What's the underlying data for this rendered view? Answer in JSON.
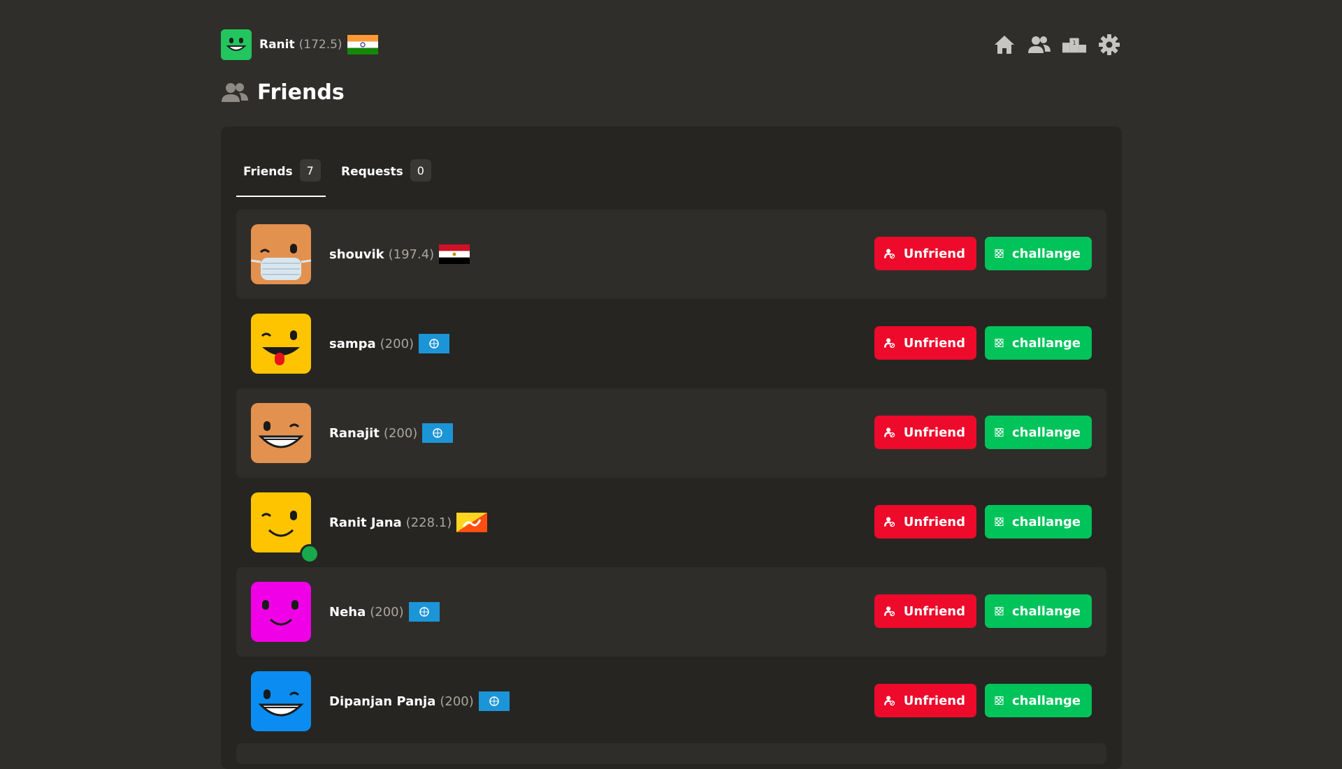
{
  "header": {
    "user": {
      "name": "Ranit",
      "rating": "(172.5)",
      "avatar_icon": "green-smile-avatar-icon",
      "flag": "india-flag-icon"
    },
    "nav": [
      {
        "name": "home-icon"
      },
      {
        "name": "friends-icon"
      },
      {
        "name": "leaderboard-icon"
      },
      {
        "name": "settings-icon"
      }
    ]
  },
  "page": {
    "title": "Friends",
    "title_icon": "friends-icon"
  },
  "tabs": [
    {
      "label": "Friends",
      "count": "7",
      "active": true
    },
    {
      "label": "Requests",
      "count": "0",
      "active": false
    }
  ],
  "buttons": {
    "unfriend_label": "Unfriend",
    "challenge_label": "challange"
  },
  "friends": [
    {
      "name": "shouvik",
      "rating": "(197.4)",
      "flag": "egypt-flag-icon",
      "avatar": "masked-face-avatar-icon",
      "online": false
    },
    {
      "name": "sampa",
      "rating": "(200)",
      "flag": "un-flag-icon",
      "avatar": "tongue-wink-face-avatar-icon",
      "online": false
    },
    {
      "name": "Ranajit",
      "rating": "(200)",
      "flag": "un-flag-icon",
      "avatar": "grin-wink-face-avatar-icon",
      "online": false
    },
    {
      "name": "Ranit Jana",
      "rating": "(228.1)",
      "flag": "bhutan-flag-icon",
      "avatar": "wink-smile-face-avatar-icon",
      "online": true
    },
    {
      "name": "Neha",
      "rating": "(200)",
      "flag": "un-flag-icon",
      "avatar": "smile-face-avatar-icon",
      "online": false
    },
    {
      "name": "Dipanjan Panja",
      "rating": "(200)",
      "flag": "un-flag-icon",
      "avatar": "grin-wink-face-avatar-icon",
      "online": false
    }
  ],
  "colors": {
    "background": "#302e2b",
    "panel": "#262522",
    "unfriend": "#ee0a2a",
    "challenge": "#00c35a"
  }
}
